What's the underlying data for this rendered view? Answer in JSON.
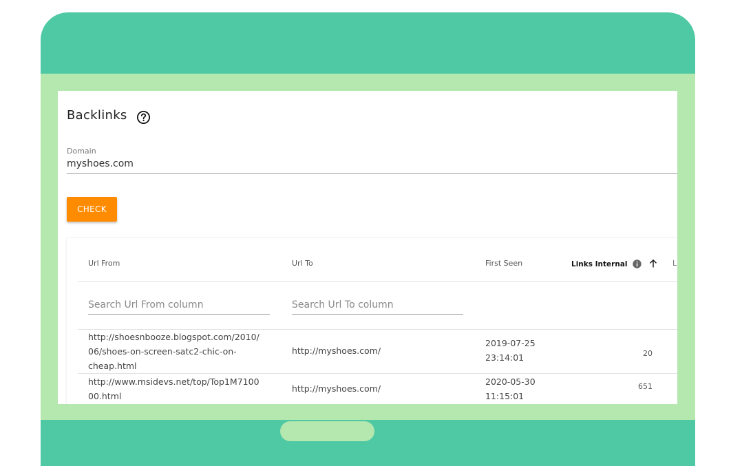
{
  "page": {
    "title": "Backlinks"
  },
  "domain_field": {
    "label": "Domain",
    "value": "myshoes.com"
  },
  "actions": {
    "check_label": "CHECK"
  },
  "table": {
    "columns": {
      "url_from": "Url From",
      "url_to": "Url To",
      "first_seen": "First Seen",
      "links_internal": "Links Internal",
      "next_cut": "L"
    },
    "search": {
      "url_from_placeholder": "Search Url From column",
      "url_to_placeholder": "Search Url To column"
    },
    "rows": [
      {
        "url_from_lines": [
          "http://shoesnbooze.blogspot.com/2010/",
          "06/shoes-on-screen-satc2-chic-on-",
          "cheap.html"
        ],
        "url_to": "http://myshoes.com/",
        "first_seen_lines": [
          "2019-07-25",
          "23:14:01"
        ],
        "links_internal": "20"
      },
      {
        "url_from_lines": [
          "http://www.msidevs.net/top/Top1M7100",
          "00.html"
        ],
        "url_to": "http://myshoes.com/",
        "first_seen_lines": [
          "2020-05-30",
          "11:15:01"
        ],
        "links_internal": "651"
      }
    ]
  },
  "icons": {
    "help": "help-circle-icon",
    "info": "info-icon",
    "sort": "arrow-up-icon"
  },
  "colors": {
    "frame": "#4fc8a4",
    "screen": "#b4e8af",
    "accent": "#ff8c00"
  }
}
